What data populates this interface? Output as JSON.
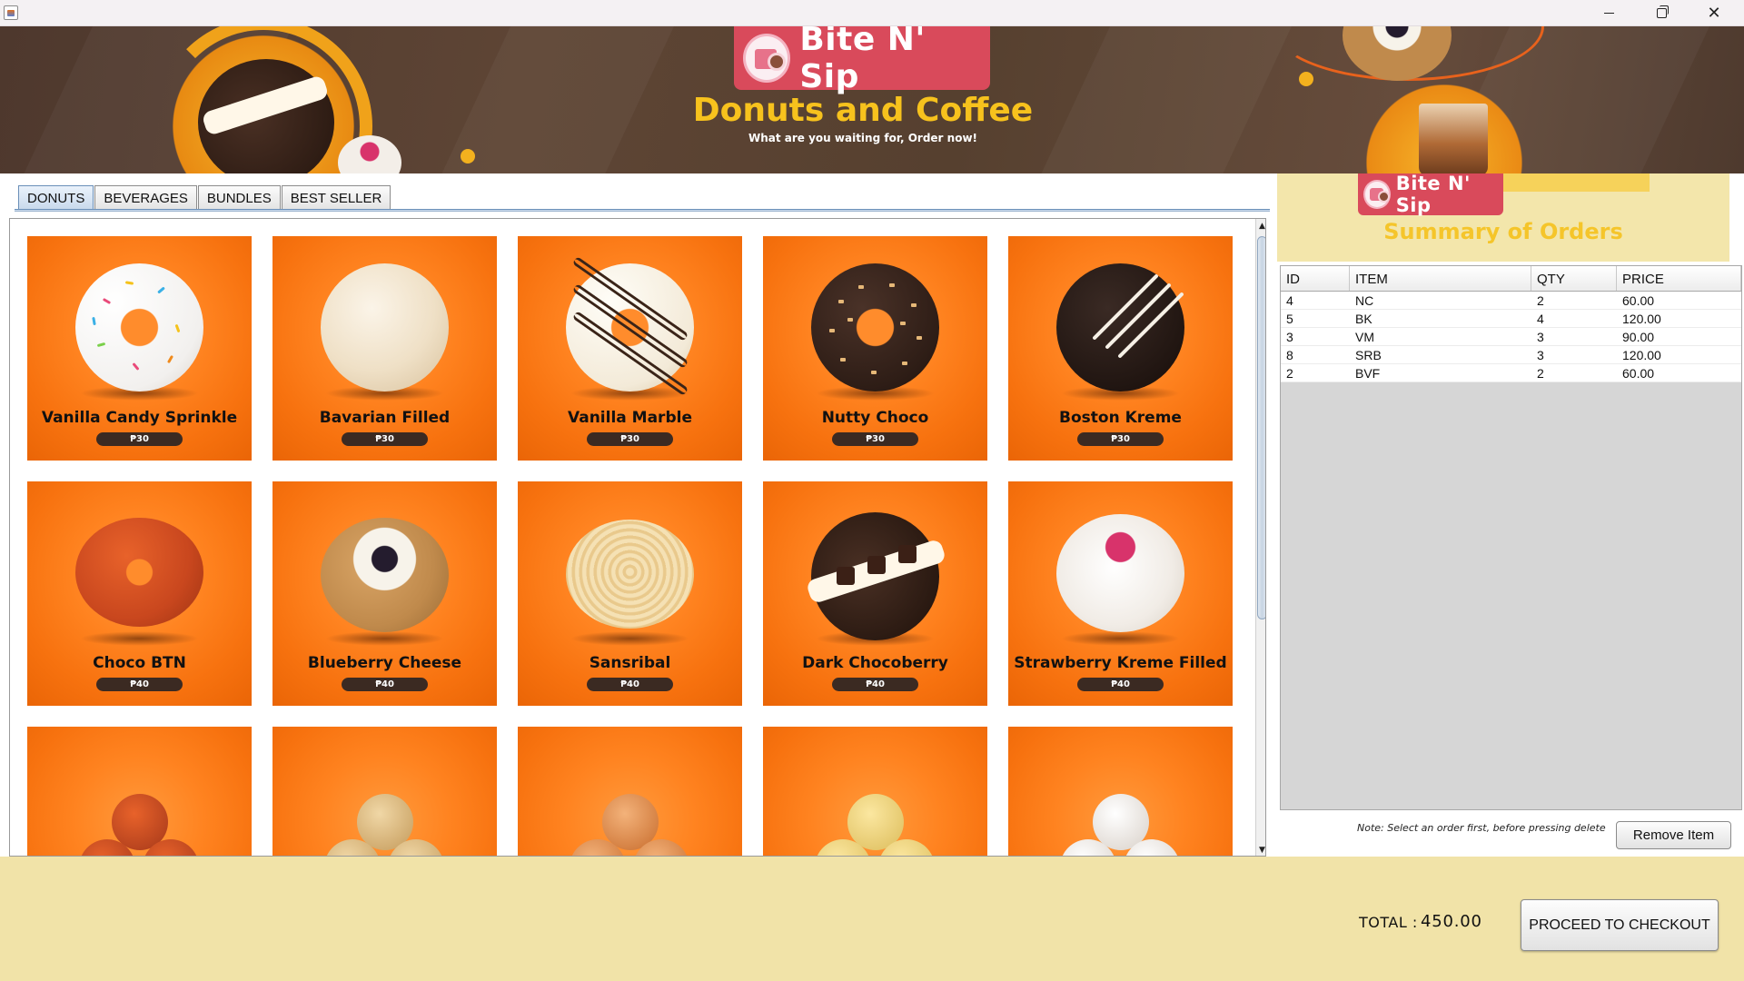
{
  "window": {
    "minimize": "—",
    "close": "✕"
  },
  "header": {
    "brand": "Bite N' Sip",
    "title": "Donuts and Coffee",
    "subtitle": "What are you waiting for, Order now!"
  },
  "tabs": [
    {
      "label": "DONUTS",
      "active": true
    },
    {
      "label": "BEVERAGES",
      "active": false
    },
    {
      "label": "BUNDLES",
      "active": false
    },
    {
      "label": "BEST SELLER",
      "active": false
    }
  ],
  "products": [
    {
      "name": "Vanilla Candy Sprinkle",
      "price": "₱30"
    },
    {
      "name": "Bavarian Filled",
      "price": "₱30"
    },
    {
      "name": "Vanilla Marble",
      "price": "₱30"
    },
    {
      "name": "Nutty Choco",
      "price": "₱30"
    },
    {
      "name": "Boston Kreme",
      "price": "₱30"
    },
    {
      "name": "Choco BTN",
      "price": "₱40"
    },
    {
      "name": "Blueberry Cheese",
      "price": "₱40"
    },
    {
      "name": "Sansribal",
      "price": "₱40"
    },
    {
      "name": "Dark Chocoberry",
      "price": "₱40"
    },
    {
      "name": "Strawberry Kreme Filled",
      "price": "₱40"
    }
  ],
  "summary": {
    "brand": "Bite N' Sip",
    "title": "Summary of Orders",
    "columns": [
      "ID",
      "ITEM",
      "QTY",
      "PRICE"
    ],
    "rows": [
      [
        "4",
        "NC",
        "2",
        "60.00"
      ],
      [
        "5",
        "BK",
        "4",
        "120.00"
      ],
      [
        "3",
        "VM",
        "3",
        "90.00"
      ],
      [
        "8",
        "SRB",
        "3",
        "120.00"
      ],
      [
        "2",
        "BVF",
        "2",
        "60.00"
      ]
    ],
    "note": "Note: Select an order first, before pressing delete",
    "remove_label": "Remove Item"
  },
  "footer": {
    "total_label": "TOTAL :",
    "total_value": "450.00",
    "checkout_label": "PROCEED TO CHECKOUT"
  },
  "colors": {
    "card_orange": "#f7720f",
    "brand_red": "#d94a5b",
    "accent_yellow": "#f7c21d",
    "footer_bg": "#f1e3a8"
  }
}
